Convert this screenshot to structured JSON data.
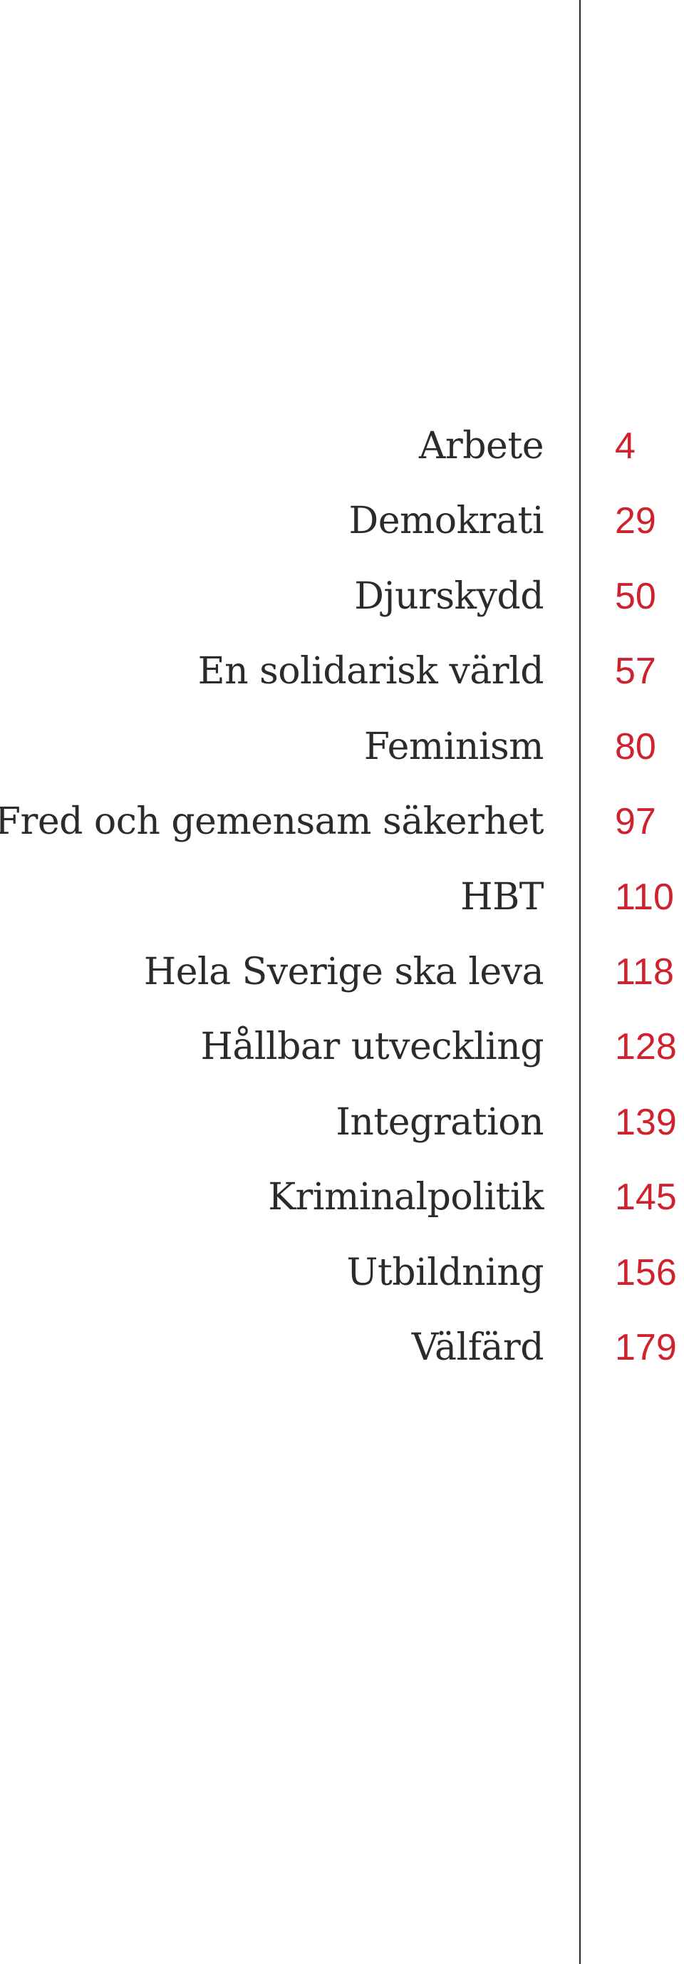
{
  "toc": {
    "accent_color": "#d0222e",
    "entries": [
      {
        "title": "Arbete",
        "page": "4"
      },
      {
        "title": "Demokrati",
        "page": "29"
      },
      {
        "title": "Djurskydd",
        "page": "50"
      },
      {
        "title": "En solidarisk värld",
        "page": "57"
      },
      {
        "title": "Feminism",
        "page": "80"
      },
      {
        "title": "Fred och gemensam säkerhet",
        "page": "97"
      },
      {
        "title": "HBT",
        "page": "110"
      },
      {
        "title": "Hela Sverige ska leva",
        "page": "118"
      },
      {
        "title": "Hållbar utveckling",
        "page": "128"
      },
      {
        "title": "Integration",
        "page": "139"
      },
      {
        "title": "Kriminalpolitik",
        "page": "145"
      },
      {
        "title": "Utbildning",
        "page": "156"
      },
      {
        "title": "Välfärd",
        "page": "179"
      }
    ]
  }
}
